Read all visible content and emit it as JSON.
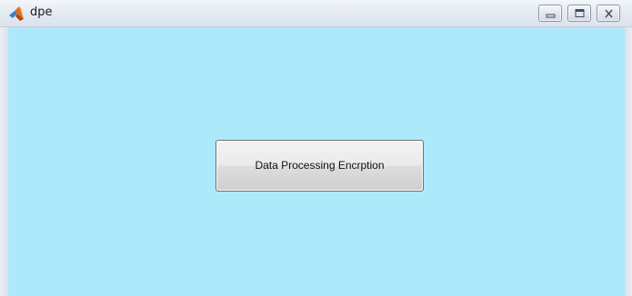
{
  "window": {
    "title": "dpe",
    "app_icon": "matlab-logo-icon",
    "client_background": "#ade9fa",
    "controls": {
      "minimize": "minimize-icon",
      "maximize": "maximize-icon",
      "close": "close-icon"
    }
  },
  "main": {
    "button_label": "Data Processing Encrption"
  }
}
